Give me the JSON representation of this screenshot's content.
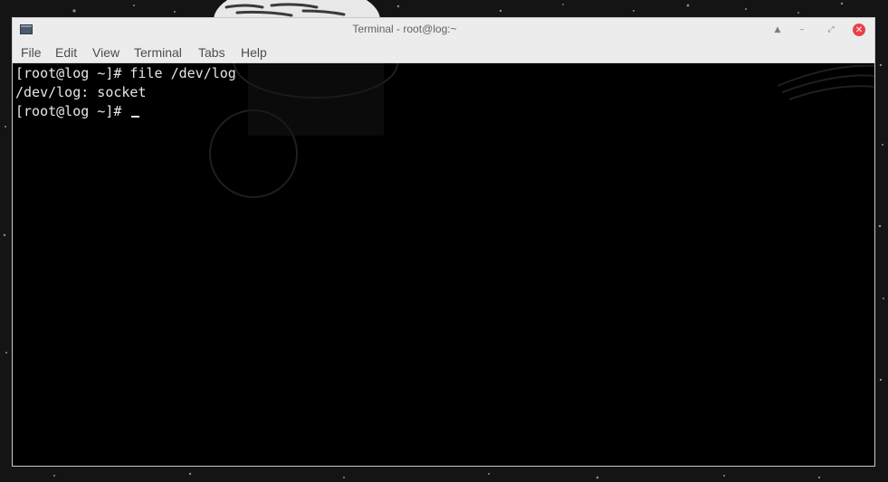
{
  "window": {
    "title": "Terminal - root@log:~",
    "controls": {
      "shade": "▲",
      "minimize": "‒",
      "maximize": "⤢",
      "close": "✕"
    }
  },
  "menubar": {
    "items": [
      "File",
      "Edit",
      "View",
      "Terminal",
      "Tabs",
      "Help"
    ]
  },
  "terminal": {
    "lines": [
      "[root@log ~]# file /dev/log",
      "/dev/log: socket",
      "[root@log ~]# "
    ]
  },
  "colors": {
    "titlebar_bg": "#ececec",
    "terminal_bg": "#000000",
    "terminal_fg": "#e6e6e6",
    "close_button": "#e9404b",
    "title_text": "#5e6368"
  },
  "icons": {
    "app": "terminal-icon",
    "shade": "shade-icon",
    "minimize": "minimize-icon",
    "maximize": "maximize-icon",
    "close": "close-icon"
  }
}
